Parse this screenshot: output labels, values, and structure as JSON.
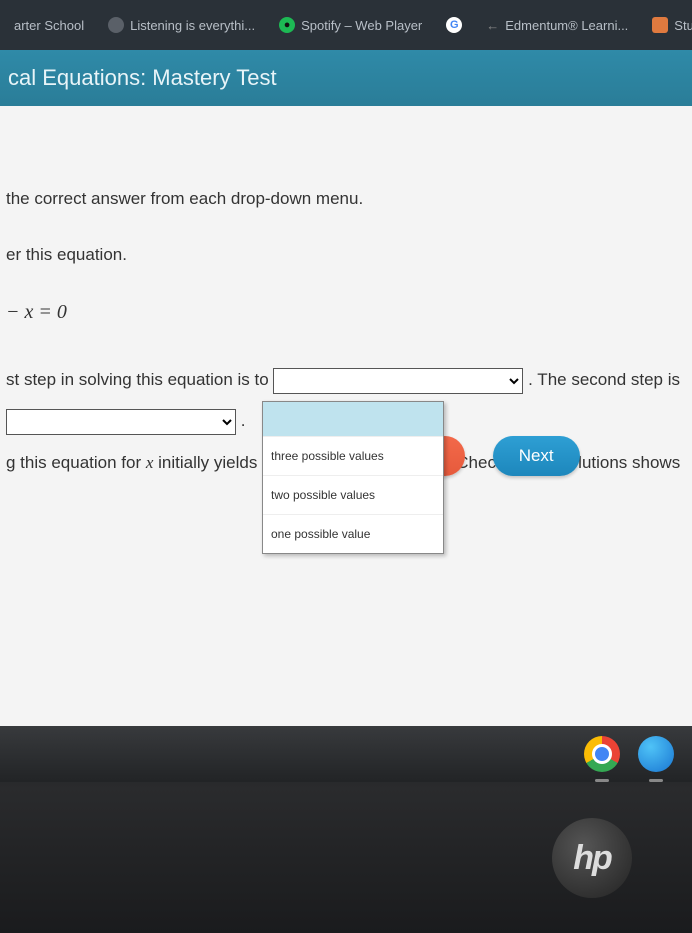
{
  "tabs": {
    "t1": "arter School",
    "t2": "Listening is everythi...",
    "t3": "Spotify – Web Player",
    "t4": "Edmentum® Learni...",
    "t5": "Stu"
  },
  "header": {
    "title": "cal Equations: Mastery Test"
  },
  "content": {
    "instruction": "the correct answer from each drop-down menu.",
    "consider": "er this equation.",
    "equation": "− x = 0",
    "line1a": "st step in solving this equation is to ",
    "line1b": " . The second step is",
    "line2": " .",
    "line3a": "g this equation for ",
    "line3x": "x",
    "line3b": " initially yields ",
    "line3c": " . Checking the solutions shows "
  },
  "dropdown3": {
    "opt_blank": "",
    "opt1": "three possible values",
    "opt2": "two possible values",
    "opt3": "one possible value"
  },
  "buttons": {
    "reset": "set",
    "next": "Next"
  },
  "logo": "hp"
}
